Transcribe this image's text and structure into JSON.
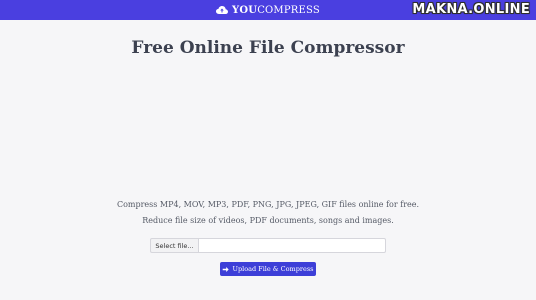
{
  "header": {
    "brand_bold": "YOU",
    "brand_rest": "COMPRESS",
    "watermark": "MAKNA.ONLINE"
  },
  "main": {
    "title": "Free Online File Compressor",
    "description_line1": "Compress MP4, MOV, MP3, PDF, PNG, JPG, JPEG, GIF files online for free.",
    "description_line2": "Reduce file size of videos, PDF documents, songs and images.",
    "file_button_label": "Select file...",
    "file_field_value": "",
    "upload_button_label": "Upload File & Compress"
  },
  "colors": {
    "header_bg": "#4a3fe0",
    "button_bg": "#3d3fd8",
    "page_bg": "#f6f6f8"
  },
  "icons": {
    "brand": "cloud-icon",
    "upload": "arrow-right-icon"
  }
}
